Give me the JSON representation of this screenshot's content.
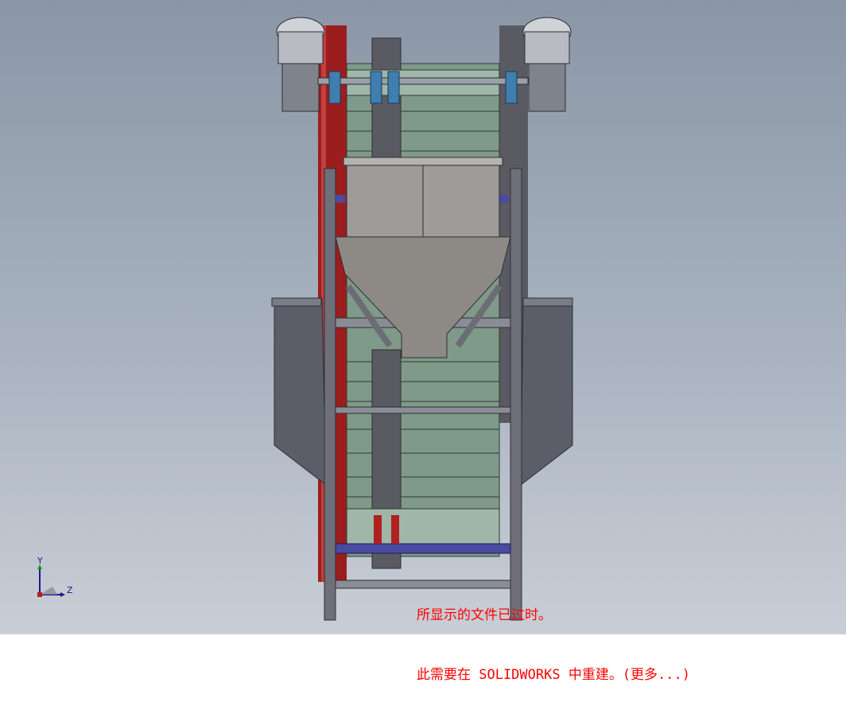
{
  "viewport": {
    "background_top": "#8a96a6",
    "background_bottom": "#c9ced6"
  },
  "model": {
    "frame_color": "#6e6f78",
    "red_side_color": "#9c1d1d",
    "belt_color": "#7f9a88",
    "motor_color": "#b8bcc2",
    "bearing_color": "#3e7fb0",
    "hopper_color": "#8d8a86",
    "crossbar_color": "#4a4aa0"
  },
  "triad": {
    "x_label": "",
    "y_label": "Y",
    "z_label": "Z"
  },
  "message": {
    "line1": "所显示的文件已过时。",
    "line2": "此需要在 SOLIDWORKS 中重建。(更多...)",
    "color": "#ff0000"
  }
}
